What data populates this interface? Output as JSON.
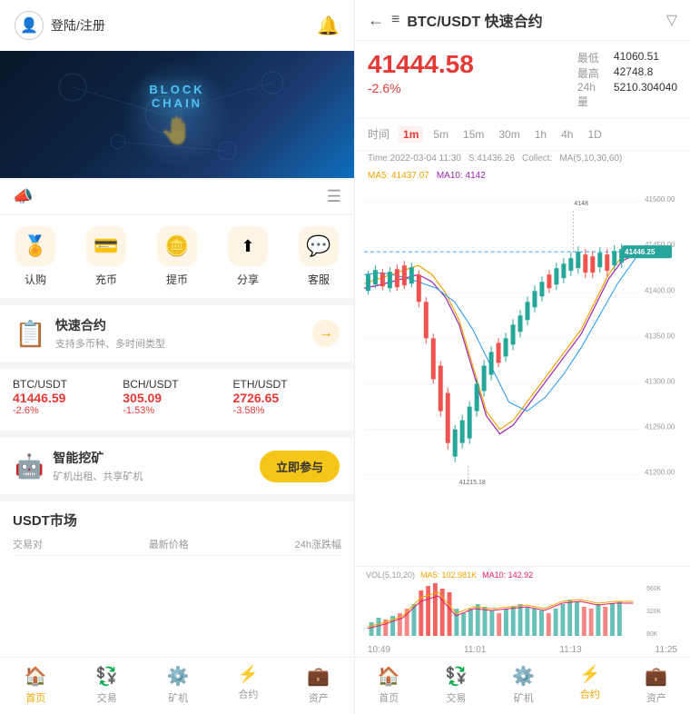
{
  "left": {
    "header": {
      "login_text": "登陆/注册",
      "bell": "🔔"
    },
    "banner": {
      "line1": "BLOCK",
      "line2": "CHAIN"
    },
    "actions": [
      {
        "icon": "🏅",
        "label": "认购"
      },
      {
        "icon": "💳",
        "label": "充币"
      },
      {
        "icon": "🪙",
        "label": "提币"
      },
      {
        "icon": "↗",
        "label": "分享"
      },
      {
        "icon": "💬",
        "label": "客服"
      }
    ],
    "contract": {
      "title": "快速合约",
      "subtitle": "支持多币种、多时间类型",
      "arrow": "→"
    },
    "market_pairs": [
      {
        "pair": "BTC/USDT",
        "price": "41446.59",
        "change": "-2.6%"
      },
      {
        "pair": "BCH/USDT",
        "price": "305.09",
        "change": "-1.53%"
      },
      {
        "pair": "ETH/USDT",
        "price": "2726.65",
        "change": "-3.58%"
      }
    ],
    "mining": {
      "title": "智能挖矿",
      "subtitle": "矿机出租、共享矿机",
      "btn": "立即参与"
    },
    "usdt_market": {
      "title": "USDT市场",
      "col1": "交易对",
      "col2": "最新价格",
      "col3": "24h涨跌幅"
    },
    "nav": [
      {
        "icon": "🏠",
        "label": "首页",
        "active": true
      },
      {
        "icon": "💱",
        "label": "交易",
        "active": false
      },
      {
        "icon": "⚙️",
        "label": "矿机",
        "active": false
      },
      {
        "icon": "📊",
        "label": "合约",
        "active": false
      },
      {
        "icon": "💼",
        "label": "资产",
        "active": false
      }
    ]
  },
  "right": {
    "header": {
      "title": "BTC/USDT 快速合约"
    },
    "price": {
      "main": "41444.58",
      "change": "-2.6%",
      "low_label": "最低",
      "low_val": "41060.51",
      "high_label": "最高",
      "high_val": "42748.8",
      "vol_label": "24h量",
      "vol_val": "5210.304040"
    },
    "time_tabs": [
      "时间",
      "1m",
      "5m",
      "15m",
      "30m",
      "1h",
      "4h",
      "1D"
    ],
    "active_tab": "1m",
    "chart_info": {
      "time": "Time:2022-03-04 11:30",
      "s_val": "S:41436.26",
      "collect": "Collect:",
      "ma_label": "MA(5,10,30,60)",
      "ma5": "MA5: 41437.07",
      "ma10": "MA10: 4142"
    },
    "chart": {
      "y_labels": [
        "41500.00",
        "41450.00",
        "41400.00",
        "41350.00",
        "41300.00",
        "41250.00",
        "41200.00"
      ],
      "price_tag": "41446.25",
      "low_mark": "41215.18",
      "high_mark": "4148"
    },
    "volume": {
      "label": "VOL(5,10,20)",
      "ma5": "MA5: 102.981K",
      "ma10": "MA10: 142.92",
      "y_labels": [
        "560K",
        "320K",
        "80K"
      ]
    },
    "x_labels": [
      "10:49",
      "11:01",
      "11:13",
      "11:25"
    ],
    "nav": [
      {
        "icon": "🏠",
        "label": "首页",
        "active": false
      },
      {
        "icon": "💱",
        "label": "交易",
        "active": false
      },
      {
        "icon": "⚙️",
        "label": "矿机",
        "active": false
      },
      {
        "icon": "📊",
        "label": "合约",
        "active": true
      },
      {
        "icon": "💼",
        "label": "资产",
        "active": false
      }
    ]
  }
}
